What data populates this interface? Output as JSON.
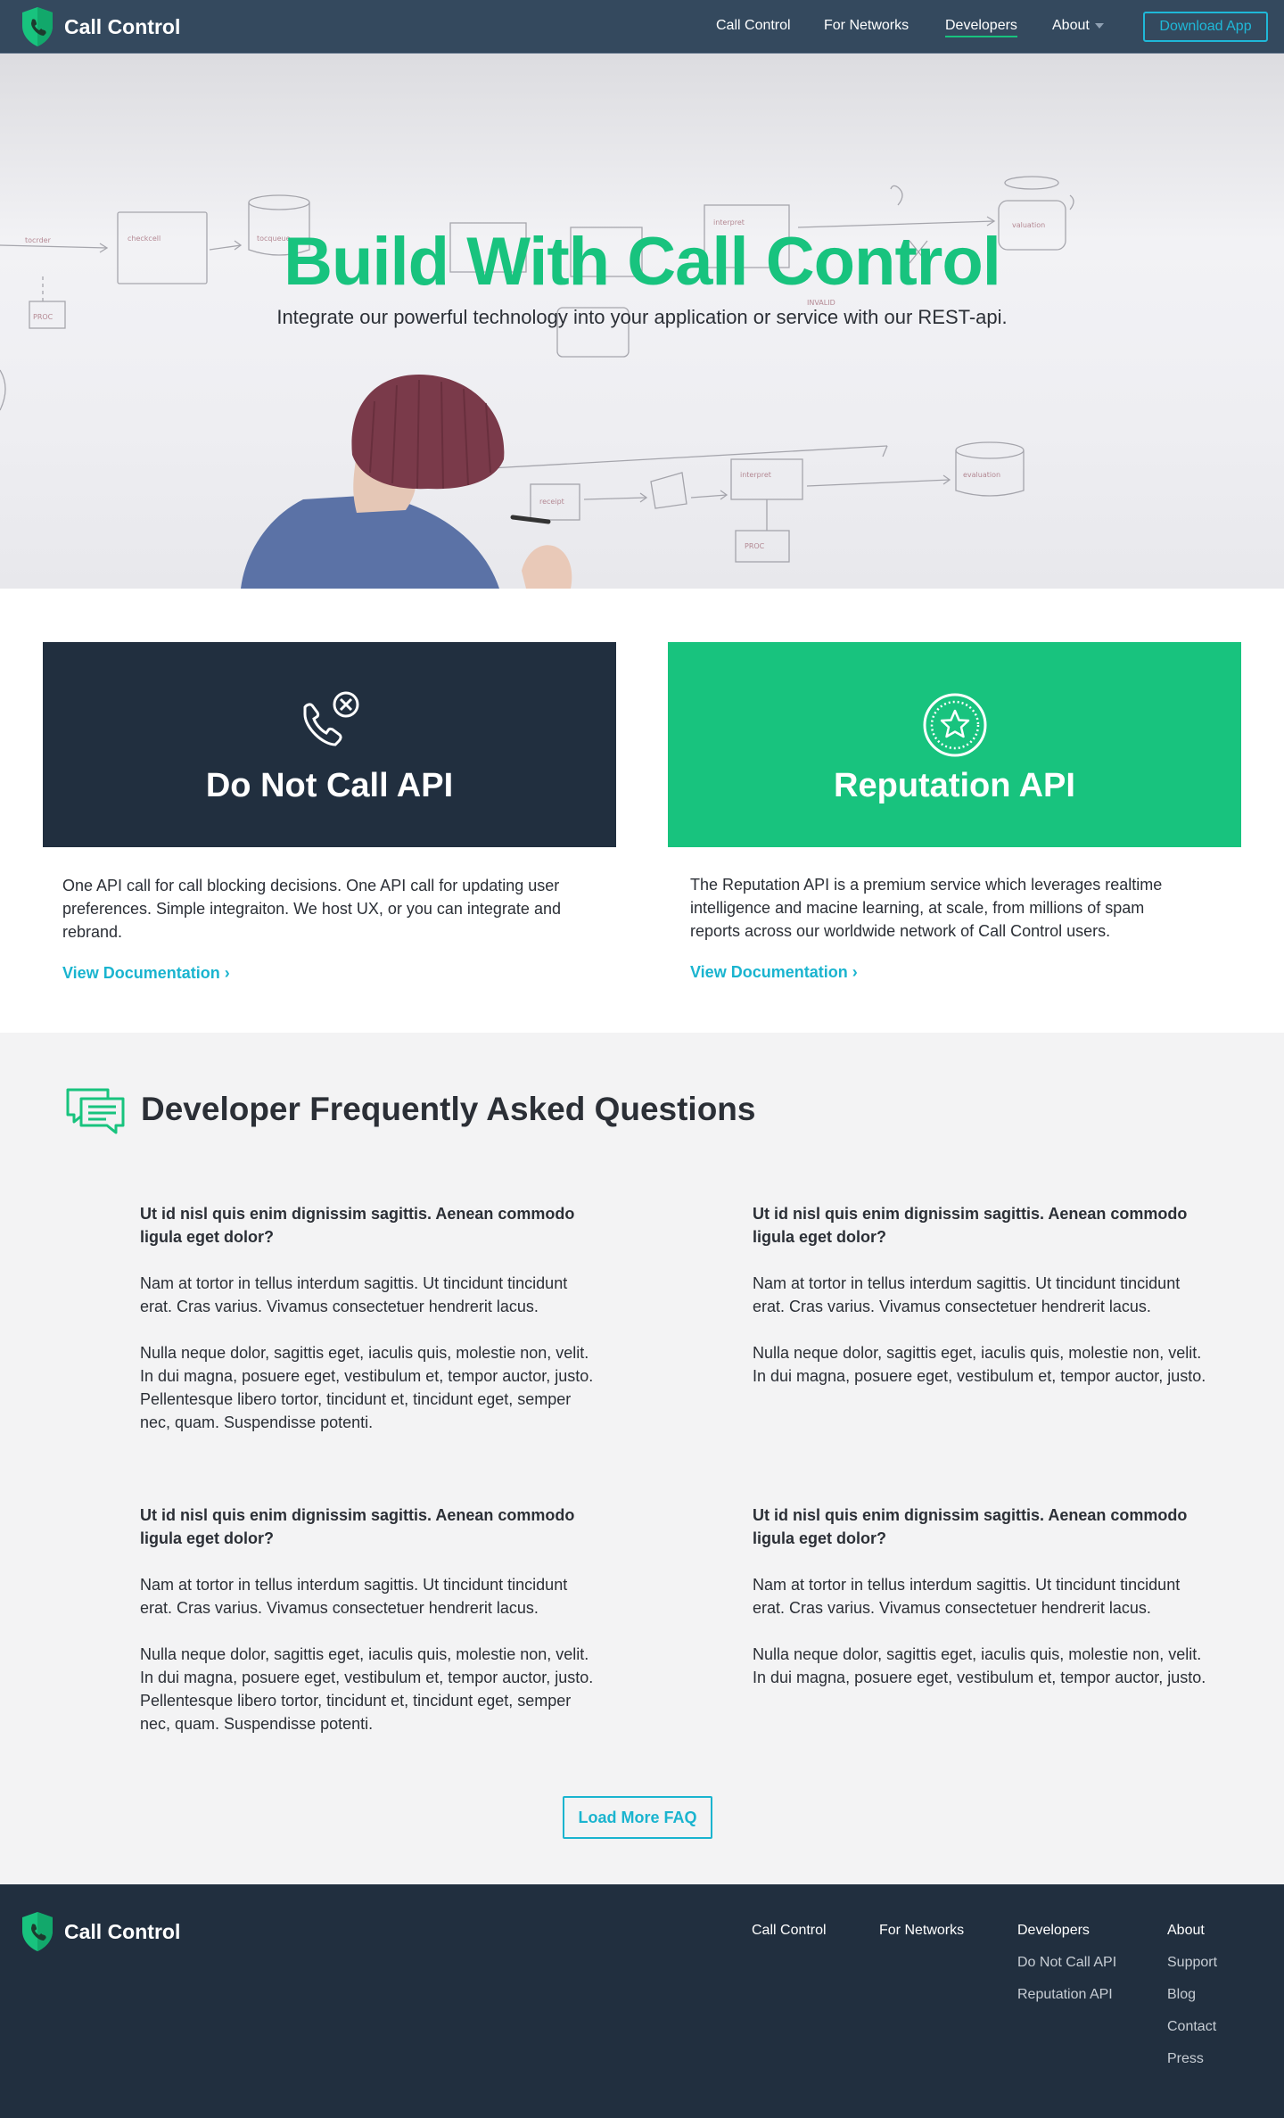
{
  "brand": {
    "name": "Call Control",
    "color": "#18c37e"
  },
  "nav": {
    "links": [
      "Call Control",
      "For Networks",
      "Developers",
      "About"
    ],
    "active": "Developers",
    "download_label": "Download App"
  },
  "hero": {
    "title": "Build With Call Control",
    "subtitle": "Integrate our powerful technology into your application or service with our REST-api."
  },
  "api_cards": [
    {
      "title": "Do Not Call API",
      "icon": "phone-blocked-icon",
      "bg": "#212f3f",
      "description": "One API call for call blocking decisions. One API call for updating user preferences. Simple integraiton. We host UX, or you can integrate and rebrand.",
      "link": "View Documentation ›"
    },
    {
      "title": "Reputation API",
      "icon": "star-badge-icon",
      "bg": "#18c37e",
      "description": "The Reputation API is a premium service which leverages realtime intelligence and macine learning, at scale, from millions of spam reports across our worldwide network of Call Control users.",
      "link": "View Documentation ›"
    }
  ],
  "faq": {
    "heading": "Developer Frequently Asked Questions",
    "icon": "chat-bubbles-icon",
    "items": [
      {
        "question": "Ut id nisl quis enim dignissim sagittis. Aenean commodo ligula eget dolor?",
        "answers": [
          "Nam at tortor in tellus interdum sagittis. Ut tincidunt tincidunt erat. Cras varius. Vivamus consectetuer hendrerit lacus.",
          "Nulla neque dolor, sagittis eget, iaculis quis, molestie non, velit. In dui magna, posuere eget, vestibulum et, tempor auctor, justo. Pellentesque libero tortor, tincidunt et, tincidunt eget, semper nec, quam. Suspendisse potenti."
        ]
      },
      {
        "question": "Ut id nisl quis enim dignissim sagittis. Aenean commodo ligula eget dolor?",
        "answers": [
          "Nam at tortor in tellus interdum sagittis. Ut tincidunt tincidunt erat. Cras varius. Vivamus consectetuer hendrerit lacus.",
          "Nulla neque dolor, sagittis eget, iaculis quis, molestie non, velit. In dui magna, posuere eget, vestibulum et, tempor auctor, justo."
        ]
      },
      {
        "question": "Ut id nisl quis enim dignissim sagittis. Aenean commodo ligula eget dolor?",
        "answers": [
          "Nam at tortor in tellus interdum sagittis. Ut tincidunt tincidunt erat. Cras varius. Vivamus consectetuer hendrerit lacus.",
          "Nulla neque dolor, sagittis eget, iaculis quis, molestie non, velit. In dui magna, posuere eget, vestibulum et, tempor auctor, justo. Pellentesque libero tortor, tincidunt et, tincidunt eget, semper nec, quam. Suspendisse potenti."
        ]
      },
      {
        "question": "Ut id nisl quis enim dignissim sagittis. Aenean commodo ligula eget dolor?",
        "answers": [
          "Nam at tortor in tellus interdum sagittis. Ut tincidunt tincidunt erat. Cras varius. Vivamus consectetuer hendrerit lacus.",
          "Nulla neque dolor, sagittis eget, iaculis quis, molestie non, velit. In dui magna, posuere eget, vestibulum et, tempor auctor, justo."
        ]
      }
    ],
    "load_more_label": "Load More FAQ"
  },
  "footer": {
    "brand": "Call Control",
    "columns": [
      {
        "heading": "Call Control",
        "links": []
      },
      {
        "heading": "For Networks",
        "links": []
      },
      {
        "heading": "Developers",
        "links": [
          "Do Not Call API",
          "Reputation API"
        ]
      },
      {
        "heading": "About",
        "links": [
          "Support",
          "Blog",
          "Contact",
          "Press"
        ]
      }
    ]
  }
}
